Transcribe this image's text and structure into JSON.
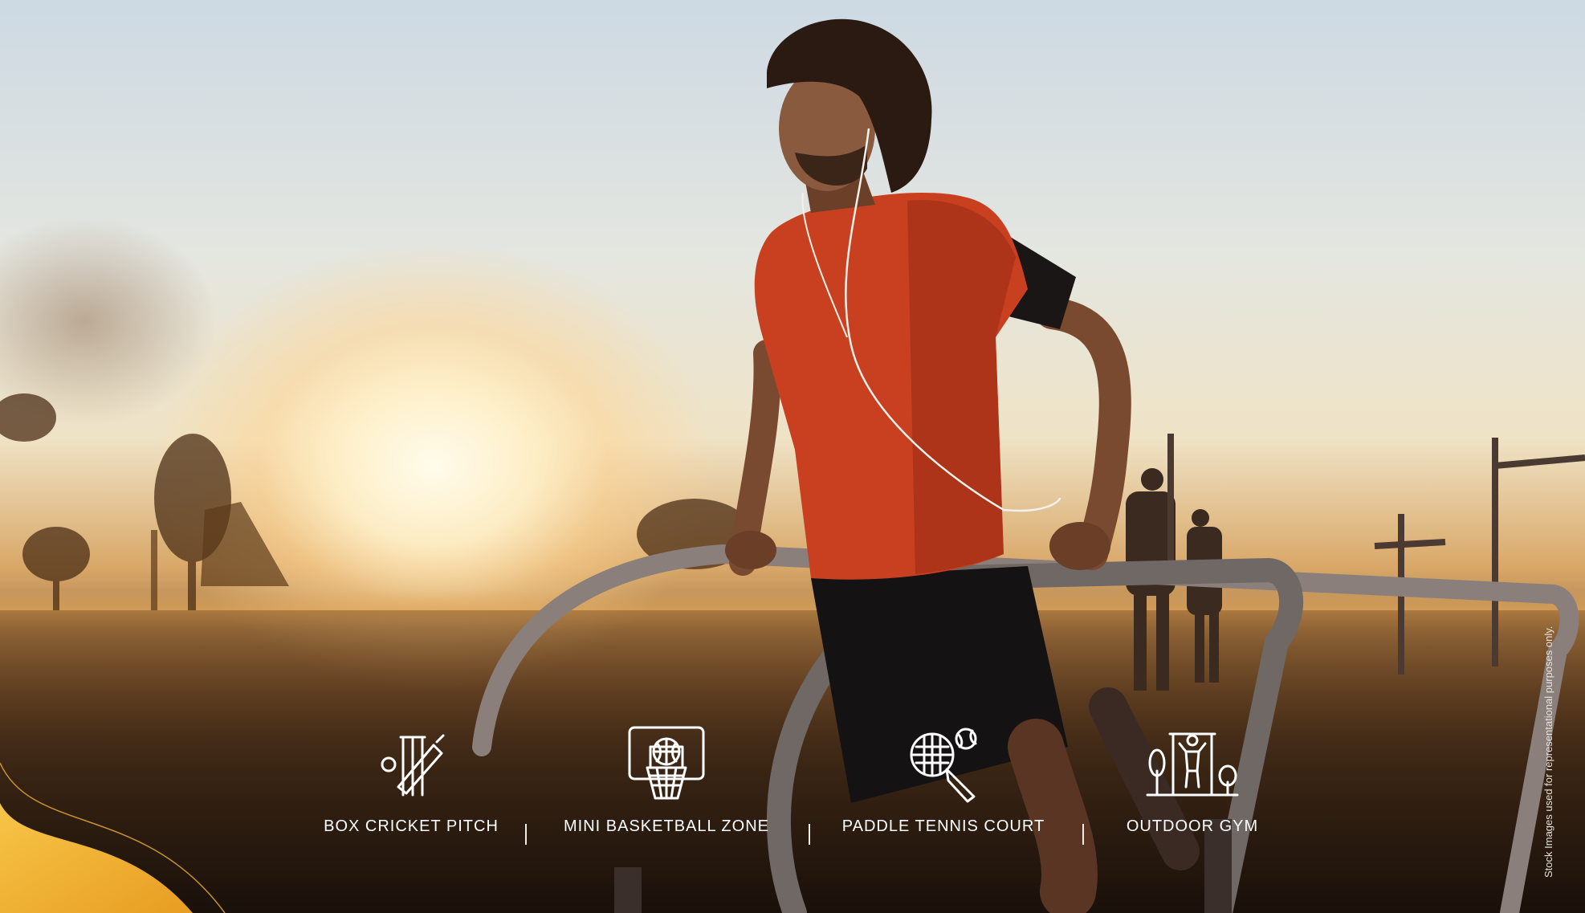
{
  "amenities": [
    {
      "label": "BOX CRICKET PITCH",
      "icon": "cricket-icon"
    },
    {
      "label": "MINI BASKETBALL ZONE",
      "icon": "basketball-icon"
    },
    {
      "label": "PADDLE TENNIS COURT",
      "icon": "tennis-icon"
    },
    {
      "label": "OUTDOOR GYM",
      "icon": "outdoor-gym-icon"
    }
  ],
  "separator": "|",
  "disclaimer": "Stock Images used for representational purposes only.",
  "colors": {
    "label": "#ffffff",
    "accent_gold": "#f2b233",
    "shirt": "#c8401f",
    "sky": "#dfe6ea"
  }
}
